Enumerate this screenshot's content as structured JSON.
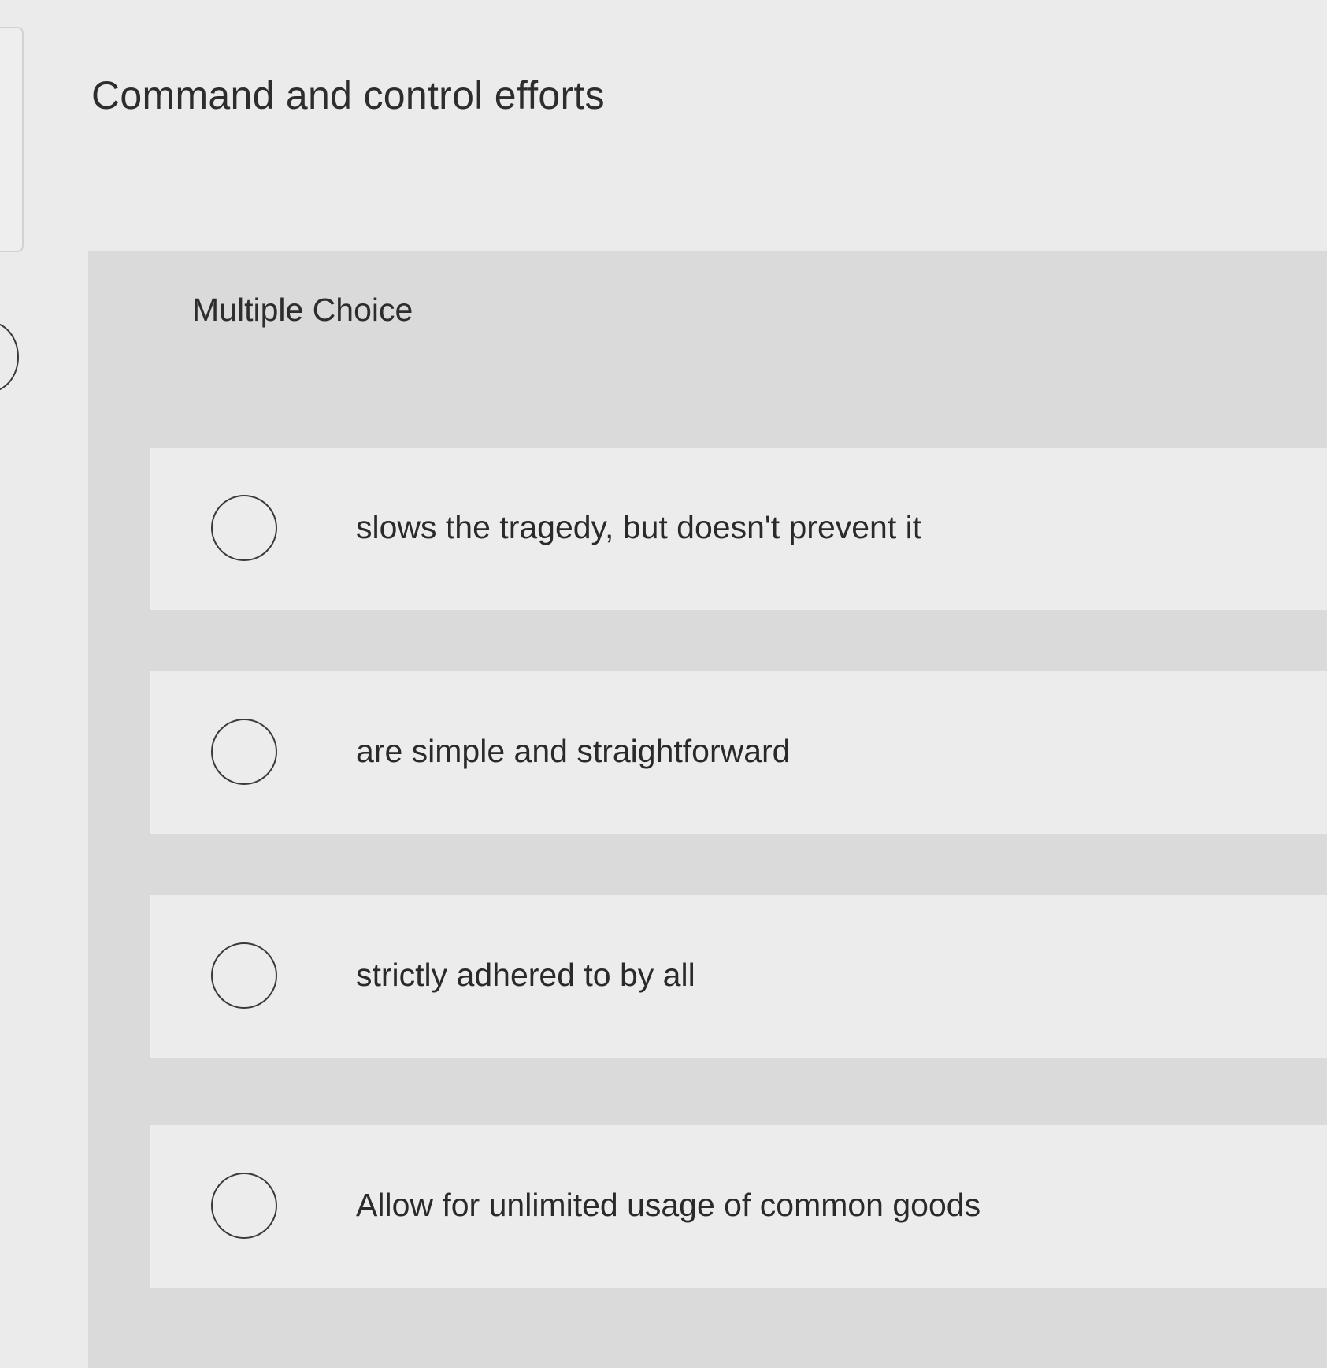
{
  "question": {
    "title": "Command and control efforts"
  },
  "multiple_choice": {
    "header": "Multiple Choice",
    "options": [
      {
        "label": "slows the tragedy, but doesn't prevent it",
        "selected": false
      },
      {
        "label": "are simple and straightforward",
        "selected": false
      },
      {
        "label": "strictly adhered to by all",
        "selected": false
      },
      {
        "label": "Allow for unlimited usage of common goods",
        "selected": false
      }
    ]
  }
}
